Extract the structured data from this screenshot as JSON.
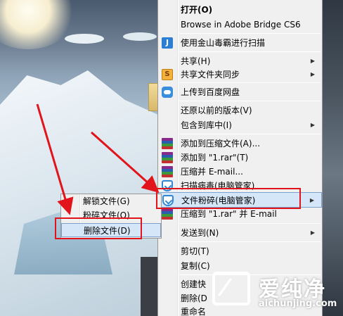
{
  "context_menu": {
    "items": [
      {
        "label": "打开(O)",
        "bold": true
      },
      {
        "label": "Browse in Adobe Bridge CS6"
      },
      {
        "label": "使用金山毒霸进行扫描",
        "icon": "jinshan-icon"
      },
      {
        "label": "共享(H)",
        "submenu": true
      },
      {
        "label": "共享文件夹同步",
        "submenu": true,
        "icon": "sync-icon"
      },
      {
        "label": "上传到百度网盘",
        "icon": "baidu-cloud-icon"
      },
      {
        "label": "还原以前的版本(V)"
      },
      {
        "label": "包含到库中(I)",
        "submenu": true
      },
      {
        "label": "添加到压缩文件(A)...",
        "icon": "winrar-icon"
      },
      {
        "label": "添加到 \"1.rar\"(T)",
        "icon": "winrar-icon"
      },
      {
        "label": "压缩并 E-mail...",
        "icon": "winrar-icon"
      },
      {
        "label": "扫描病毒(电脑管家)",
        "icon": "tencent-shield-icon"
      },
      {
        "label": "文件粉碎(电脑管家)",
        "submenu": true,
        "icon": "tencent-shield-icon",
        "highlighted": true
      },
      {
        "label": "压缩到 \"1.rar\" 并 E-mail",
        "icon": "winrar-icon"
      },
      {
        "label": "发送到(N)",
        "submenu": true
      },
      {
        "label": "剪切(T)"
      },
      {
        "label": "复制(C)"
      },
      {
        "label": "创建快"
      },
      {
        "label": "删除(D"
      },
      {
        "label": "重命名"
      }
    ]
  },
  "submenu": {
    "items": [
      {
        "label": "解锁文件(G)"
      },
      {
        "label": "粉碎文件(O)"
      },
      {
        "label": "删除文件(D)",
        "highlighted": true
      }
    ]
  },
  "watermark": {
    "title": "爱纯净",
    "url": "aichunjing.com"
  },
  "colors": {
    "menu_bg": "#f0f0f0",
    "highlight_bg": "#d5e6f8",
    "highlight_border": "#7da2ce",
    "annotation_red": "#e0141a"
  }
}
